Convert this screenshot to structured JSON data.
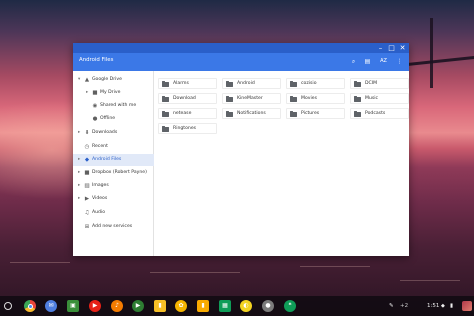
{
  "window": {
    "app_title": "Android Files",
    "controls": [
      "minimize-icon",
      "maximize-icon",
      "close-icon"
    ],
    "toolbar": {
      "search_icon": "search-icon",
      "view_icon": "grid-view-icon",
      "sort_label": "AZ",
      "more_icon": "more-vert-icon"
    },
    "sidebar": [
      {
        "label": "Google Drive",
        "icon": "drive-icon",
        "caret": "▾",
        "indent": 0
      },
      {
        "label": "My Drive",
        "icon": "folder-icon",
        "caret": "▸",
        "indent": 1
      },
      {
        "label": "Shared with me",
        "icon": "people-icon",
        "caret": "",
        "indent": 1
      },
      {
        "label": "Offline",
        "icon": "offline-pin-icon",
        "caret": "",
        "indent": 1
      },
      {
        "label": "Downloads",
        "icon": "download-icon",
        "caret": "▸",
        "indent": 0
      },
      {
        "label": "Recent",
        "icon": "clock-icon",
        "caret": "",
        "indent": 0
      },
      {
        "label": "Android Files",
        "icon": "android-icon",
        "caret": "▸",
        "indent": 0,
        "selected": true
      },
      {
        "label": "Dropbox (Robert Payne)",
        "icon": "folder-icon",
        "caret": "▸",
        "indent": 0
      },
      {
        "label": "Images",
        "icon": "image-icon",
        "caret": "▸",
        "indent": 0
      },
      {
        "label": "Videos",
        "icon": "video-icon",
        "caret": "▸",
        "indent": 0
      },
      {
        "label": "Audio",
        "icon": "audio-icon",
        "caret": "",
        "indent": 0
      },
      {
        "label": "Add new services",
        "icon": "add-icon",
        "caret": "",
        "indent": 0
      }
    ],
    "folders": [
      "Alarms",
      "Android",
      "cozisio",
      "DCIM",
      "Download",
      "KineMaster",
      "Movies",
      "Music",
      "netease",
      "Notifications",
      "Pictures",
      "Podcasts",
      "Ringtones"
    ]
  },
  "shelf": {
    "apps": [
      {
        "name": "chrome-icon",
        "color": "#e8453c",
        "glyph": ""
      },
      {
        "name": "gmail-icon",
        "color": "#4f7fe0",
        "glyph": "✉"
      },
      {
        "name": "files-icon",
        "color": "#3a8f3a",
        "glyph": "▣"
      },
      {
        "name": "youtube-icon",
        "color": "#e62117",
        "glyph": "▶"
      },
      {
        "name": "music-icon",
        "color": "#f57c00",
        "glyph": "♪"
      },
      {
        "name": "play-store-icon",
        "color": "#2e7d32",
        "glyph": "▶"
      },
      {
        "name": "keep-icon",
        "color": "#f6bf26",
        "glyph": "▮"
      },
      {
        "name": "photos-icon",
        "color": "#f4b400",
        "glyph": "✿"
      },
      {
        "name": "analytics-icon",
        "color": "#f9ab00",
        "glyph": "▮"
      },
      {
        "name": "sheets-icon",
        "color": "#0f9d58",
        "glyph": "▦"
      },
      {
        "name": "lemon-app-icon",
        "color": "#f3d321",
        "glyph": "◐"
      },
      {
        "name": "tasks-icon",
        "color": "#7b7b7b",
        "glyph": "●"
      },
      {
        "name": "hangouts-icon",
        "color": "#0f9d58",
        "glyph": "❝"
      }
    ],
    "tray": {
      "stylus_icon": "✎",
      "notification_count": "+2",
      "time": "1:51",
      "wifi_glyph": "◆",
      "battery_glyph": "▮"
    }
  }
}
